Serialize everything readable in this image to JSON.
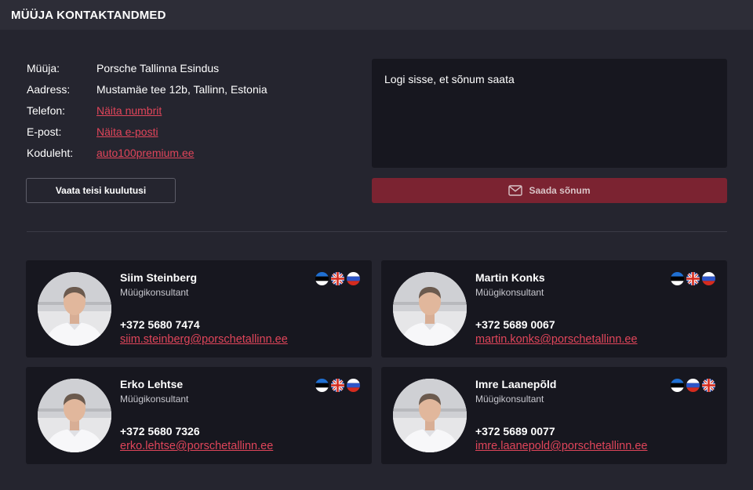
{
  "header": {
    "title": "MÜÜJA KONTAKTANDMED"
  },
  "seller": {
    "rows": [
      {
        "key": "Müüja:",
        "value": "Porsche Tallinna Esindus"
      },
      {
        "key": "Aadress:",
        "value": "Mustamäe tee 12b, Tallinn, Estonia"
      },
      {
        "key": "Telefon:",
        "value": "Näita numbrit"
      },
      {
        "key": "E-post:",
        "value": "Näita e-posti"
      },
      {
        "key": "Koduleht:",
        "value": "auto100premium.ee"
      }
    ],
    "other_ads_label": "Vaata teisi kuulutusi"
  },
  "message": {
    "placeholder": "Logi sisse, et sõnum saata",
    "send_label": "Saada sõnum",
    "send_icon": "envelope-icon"
  },
  "colors": {
    "background": "#25252f",
    "card": "#17171f",
    "accent": "#e0455a",
    "send_button": "#7b2331"
  },
  "consultants": [
    {
      "name": "Siim Steinberg",
      "role": "Müügikonsultant",
      "phone": "+372 5680 7474",
      "email": "siim.steinberg@porschetallinn.ee",
      "flags": [
        "estonia-flag-icon",
        "uk-flag-icon",
        "russia-flag-icon"
      ]
    },
    {
      "name": "Martin Konks",
      "role": "Müügikonsultant",
      "phone": "+372 5689 0067",
      "email": "martin.konks@porschetallinn.ee",
      "flags": [
        "estonia-flag-icon",
        "uk-flag-icon",
        "russia-flag-icon"
      ]
    },
    {
      "name": "Erko Lehtse",
      "role": "Müügikonsultant",
      "phone": "+372 5680 7326",
      "email": "erko.lehtse@porschetallinn.ee",
      "flags": [
        "estonia-flag-icon",
        "uk-flag-icon",
        "russia-flag-icon"
      ]
    },
    {
      "name": "Imre Laanepõld",
      "role": "Müügikonsultant",
      "phone": "+372 5689 0077",
      "email": "imre.laanepold@porschetallinn.ee",
      "flags": [
        "estonia-flag-icon",
        "russia-flag-icon",
        "uk-flag-icon"
      ]
    }
  ]
}
